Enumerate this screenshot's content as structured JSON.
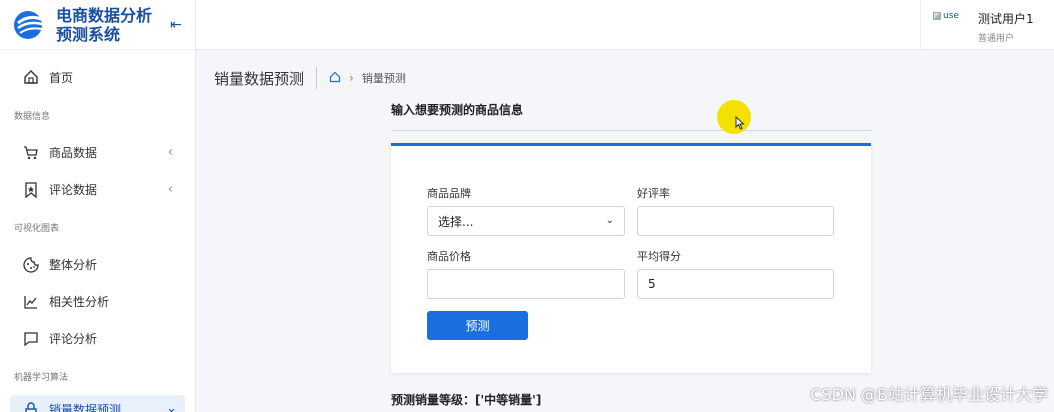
{
  "brand": {
    "title_line1": "电商数据分析",
    "title_line2": "预测系统"
  },
  "sidebar": {
    "home": "首页",
    "group1": "数据信息",
    "goods": "商品数据",
    "reviews": "评论数据",
    "group2": "可视化图表",
    "overall": "整体分析",
    "correlation": "相关性分析",
    "review_analysis": "评论分析",
    "group3": "机器学习算法",
    "sales_predict": "销量数据预测"
  },
  "user": {
    "avatar_alt": "use",
    "name": "测试用户1",
    "role": "普通用户"
  },
  "breadcrumb": {
    "page_title": "销量数据预测",
    "current": "销量预测"
  },
  "form": {
    "section_title": "输入想要预测的商品信息",
    "brand_label": "商品品牌",
    "brand_value": "选择...",
    "rating_label": "好评率",
    "rating_value": "",
    "price_label": "商品价格",
    "price_value": "",
    "score_label": "平均得分",
    "score_value": "5",
    "submit": "预测"
  },
  "result": {
    "text": "预测销量等级：['中等销量']"
  },
  "watermark": "CSDN @B站计算机毕业设计大学",
  "colors": {
    "primary": "#1a6fe0",
    "brand": "#1a4fa0",
    "cursor_highlight": "#f5e100"
  }
}
